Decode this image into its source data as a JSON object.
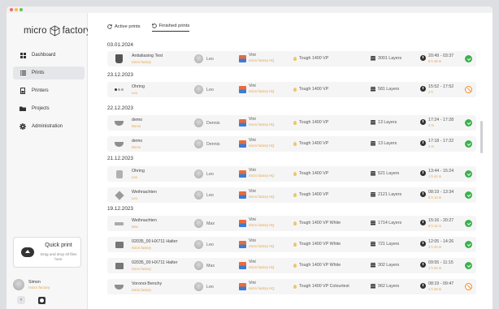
{
  "app": {
    "logo_left": "micro",
    "logo_right": "factory"
  },
  "sidebar": {
    "items": [
      {
        "label": "Dashboard",
        "icon": "dashboard-icon"
      },
      {
        "label": "Prints",
        "icon": "list-icon",
        "active": true
      },
      {
        "label": "Printers",
        "icon": "printer-icon"
      },
      {
        "label": "Projects",
        "icon": "folder-icon"
      },
      {
        "label": "Administration",
        "icon": "gear-icon"
      }
    ],
    "quick_print": {
      "title": "Quick print",
      "hint": "Drag and drop stl files here",
      "icon": "cloud-upload-icon"
    },
    "user": {
      "name": "Simon",
      "org": "micro factory"
    }
  },
  "tabs": [
    {
      "label": "Active prints",
      "icon": "refresh-icon"
    },
    {
      "label": "Finished prints",
      "icon": "history-icon",
      "active": true
    }
  ],
  "groups": [
    {
      "date": "03.01.2024",
      "rows": [
        {
          "name": "Antialiasing Test",
          "sub": "micro factory",
          "user": "Leo",
          "loc": "Vini",
          "loc_sub": "micro factory HQ",
          "material": "Tough 1400 VP",
          "layers": "3001 Layers",
          "time": "20:49 - 03:37",
          "duration": "6 h 48 m",
          "status": "ok"
        }
      ]
    },
    {
      "date": "23.12.2023",
      "rows": [
        {
          "name": "Ohring",
          "sub": "Leo",
          "user": "Leo",
          "loc": "Vini",
          "loc_sub": "micro factory HQ",
          "material": "Tough 1400 VP",
          "layers": "581 Layers",
          "time": "15:52 - 17:52",
          "duration": "2 h",
          "status": "cancel"
        }
      ]
    },
    {
      "date": "22.12.2023",
      "rows": [
        {
          "name": "demo",
          "sub": "Demo",
          "user": "Dennis",
          "loc": "Vini",
          "loc_sub": "micro factory HQ",
          "material": "Tough 1400 VP",
          "layers": "13 Layers",
          "time": "17:24 - 17:28",
          "duration": "4 m",
          "status": "ok"
        },
        {
          "name": "demo",
          "sub": "Demo",
          "user": "Dennis",
          "loc": "Vini",
          "loc_sub": "micro factory HQ",
          "material": "Tough 1400 VP",
          "layers": "13 Layers",
          "time": "17:18 - 17:22",
          "duration": "4 m",
          "status": "ok"
        }
      ]
    },
    {
      "date": "21.12.2023",
      "rows": [
        {
          "name": "Ohring",
          "sub": "Leo",
          "user": "Leo",
          "loc": "Vini",
          "loc_sub": "micro factory HQ",
          "material": "Tough 1400 VP",
          "layers": "521 Layers",
          "time": "13:44 - 15:24",
          "duration": "1 h 41 m",
          "status": "ok"
        },
        {
          "name": "Weihnachten",
          "sub": "Leo",
          "user": "Leo",
          "loc": "Vini",
          "loc_sub": "micro factory HQ",
          "material": "Tough 1400 VP",
          "layers": "2121 Layers",
          "time": "08:19 - 13:34",
          "duration": "5 h 14 m",
          "status": "ok"
        }
      ]
    },
    {
      "date": "19.12.2023",
      "rows": [
        {
          "name": "Weihnachten",
          "sub": "Max",
          "user": "Max",
          "loc": "Vini",
          "loc_sub": "micro factory HQ",
          "material": "Tough 1400 VP White",
          "layers": "1714 Layers",
          "time": "15:16 - 20:27",
          "duration": "5 h 11 m",
          "status": "ok"
        },
        {
          "name": "02035_00 HX711 Halter",
          "sub": "micro factory",
          "user": "Leo",
          "loc": "Vini",
          "loc_sub": "micro factory HQ",
          "material": "Tough 1400 VP White",
          "layers": "721 Layers",
          "time": "12:05 - 14:26",
          "duration": "2 h 20 m",
          "status": "ok"
        },
        {
          "name": "02035_00 HX711 Halter",
          "sub": "micro factory",
          "user": "Max",
          "loc": "Vini",
          "loc_sub": "micro factory HQ",
          "material": "Tough 1400 VP White",
          "layers": "302 Layers",
          "time": "09:55 - 11:15",
          "duration": "1 h 20 m",
          "status": "ok"
        },
        {
          "name": "Voronoi Benchy",
          "sub": "micro factory",
          "user": "Leo",
          "loc": "Vini",
          "loc_sub": "micro factory HQ",
          "material": "Tough 1400 VP Colourtest",
          "layers": "962 Layers",
          "time": "08:19 - 09:47",
          "duration": "1 h 28 m",
          "status": "cancel"
        }
      ]
    }
  ]
}
